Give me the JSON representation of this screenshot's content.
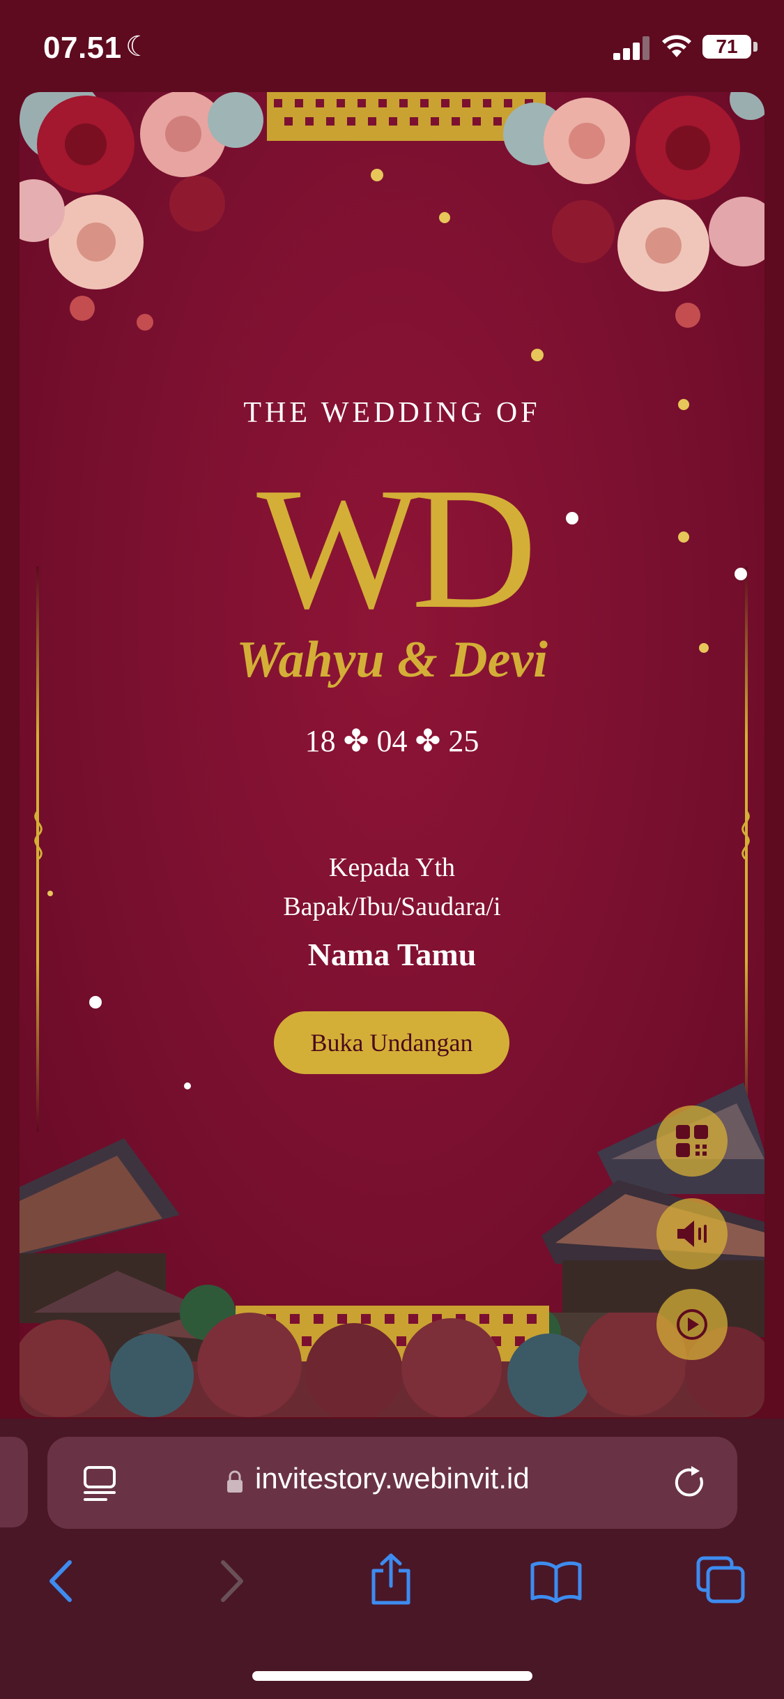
{
  "status": {
    "time": "07.51",
    "battery": "71"
  },
  "invite": {
    "heading": "THE WEDDING OF",
    "monogram": "WD",
    "couple": "Wahyu & Devi",
    "date": "18 ✤ 04 ✤ 25",
    "salutation": "Kepada Yth",
    "recipient_group": "Bapak/Ibu/Saudara/i",
    "guest_name": "Nama Tamu",
    "open_button": "Buka Undangan"
  },
  "floating_buttons": [
    "qr-code",
    "sound",
    "play"
  ],
  "browser": {
    "url": "invitestory.webinvit.id"
  },
  "colors": {
    "background": "#5e0a1f",
    "card": "#7c1030",
    "gold": "#d4af37",
    "browser_bar": "#4a1727"
  }
}
